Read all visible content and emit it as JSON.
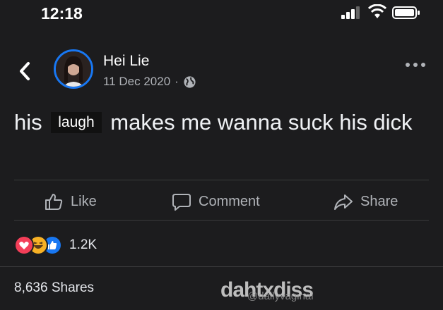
{
  "status_bar": {
    "time": "12:18"
  },
  "post": {
    "author": "Hei Lie",
    "date": "11 Dec 2020",
    "separator": "·",
    "text_before": "his",
    "redacted_label": "laugh",
    "text_after": "makes me wanna suck his dick"
  },
  "actions": {
    "like": "Like",
    "comment": "Comment",
    "share": "Share"
  },
  "reactions": {
    "count": "1.2K",
    "types": [
      "love-reaction-icon",
      "haha-reaction-icon",
      "like-reaction-icon"
    ]
  },
  "footer": {
    "shares": "8,636 Shares"
  },
  "watermark": {
    "text": "dahtxdiss",
    "small_text": "@dailyvaginal"
  },
  "colors": {
    "background": "#1c1c1e",
    "accent": "#1877f2",
    "muted": "#b0b3b8",
    "love": "#f33e58",
    "haha": "#f7b125"
  }
}
